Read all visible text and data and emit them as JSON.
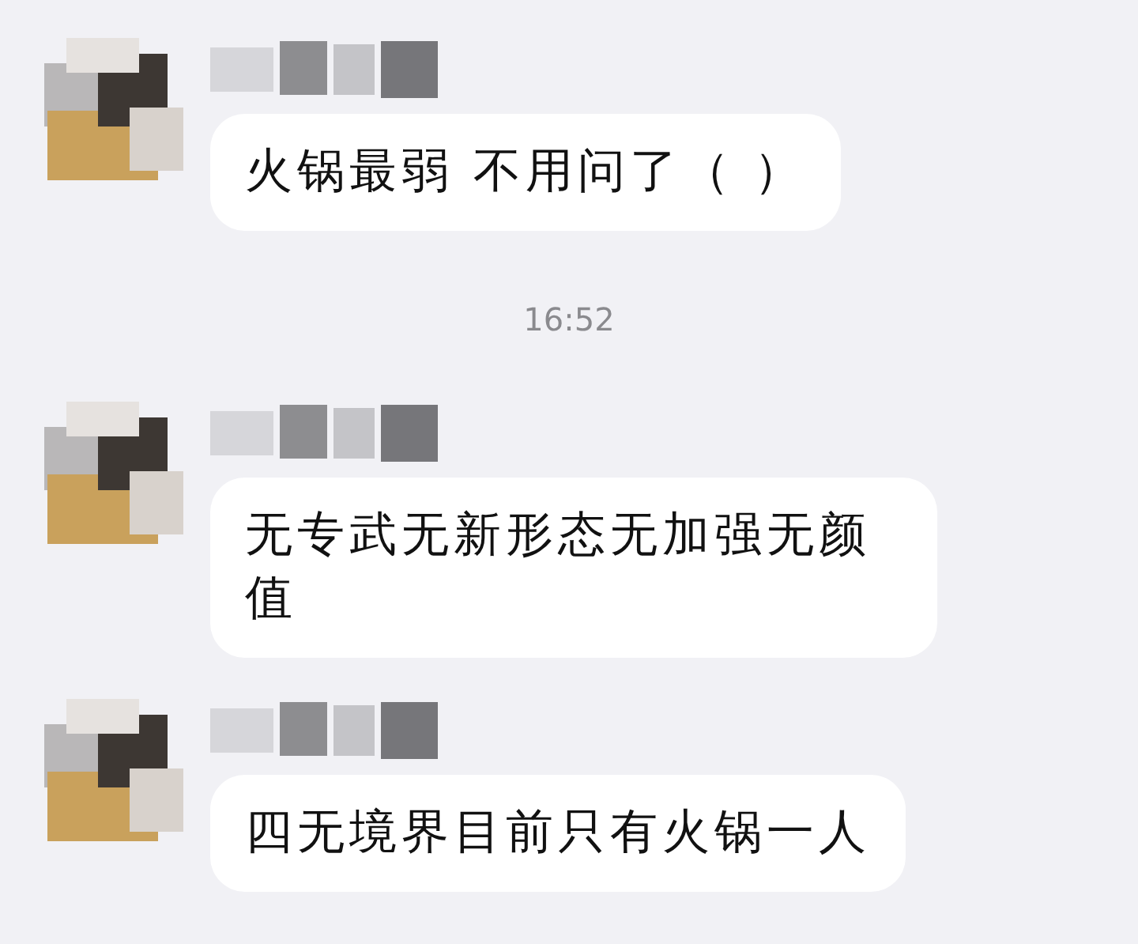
{
  "chat": [
    {
      "kind": "message",
      "text": "火锅最弱 不用问了（ ）"
    },
    {
      "kind": "time",
      "text": "16:52"
    },
    {
      "kind": "message",
      "text": "无专武无新形态无加强无颜值"
    },
    {
      "kind": "message",
      "text": "四无境界目前只有火锅一人"
    }
  ]
}
